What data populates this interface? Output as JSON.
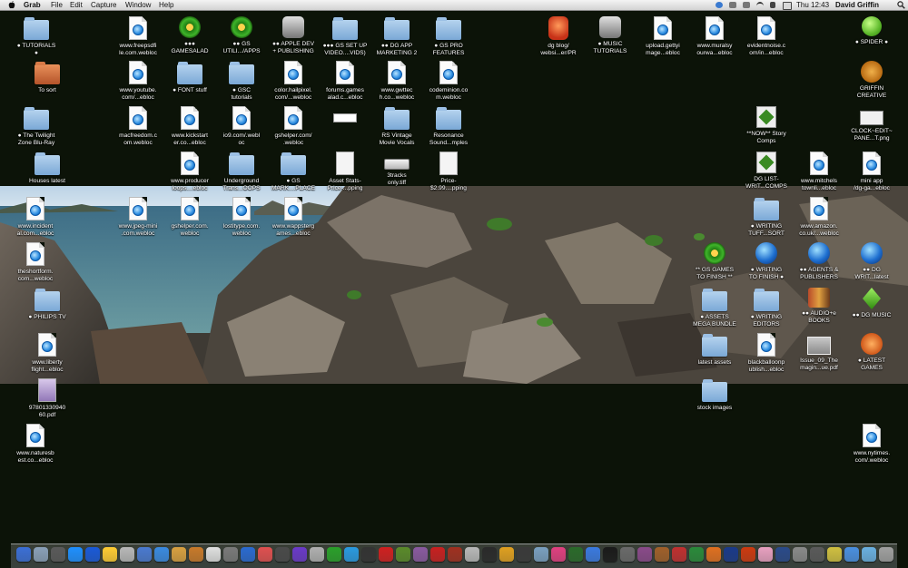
{
  "menubar": {
    "app": "Grab",
    "menus": [
      "File",
      "Edit",
      "Capture",
      "Window",
      "Help"
    ],
    "clock": "Thu 12:43",
    "user": "David Griffin"
  },
  "desktop_icons": [
    {
      "label": "● TUTORIALS\n●",
      "type": "folder"
    },
    {
      "label": "To sort",
      "type": "folder-orange"
    },
    {
      "label": "● The Twilight\nZone Blu-Ray",
      "type": "folder"
    },
    {
      "label": "Houses latest",
      "type": "folder"
    },
    {
      "label": "www.incident\nal.com...ebloc",
      "type": "webloc"
    },
    {
      "label": "theshortform.\ncom...webloc",
      "type": "webloc"
    },
    {
      "label": "● PHILIPS TV",
      "type": "folder"
    },
    {
      "label": "www.liberty\nflight...ebloc",
      "type": "webloc"
    },
    {
      "label": "97801330940\n60.pdf",
      "type": "doc-purple"
    },
    {
      "label": "www.naturesb\nest.co...ebloc",
      "type": "webloc"
    },
    {
      "label": "www.freepsdfi\nle.com.webloc",
      "type": "webloc"
    },
    {
      "label": "www.youtube.\ncom/...ebloc",
      "type": "webloc"
    },
    {
      "label": "macfreedom.c\nom.webloc",
      "type": "webloc"
    },
    {
      "label": "www.producer\nloops....ebloc",
      "type": "webloc"
    },
    {
      "label": "www.jpeg-mini\n.com.webloc",
      "type": "webloc"
    },
    {
      "label": "●●●\nGAMESALAD",
      "type": "wreath"
    },
    {
      "label": "● FONT stuff",
      "type": "folder"
    },
    {
      "label": "www.kickstart\ner.co...ebloc",
      "type": "webloc"
    },
    {
      "label": "Underground\nTrans...OOPS",
      "type": "folder"
    },
    {
      "label": "gshelper.com.\nwebloc",
      "type": "webloc"
    },
    {
      "label": "●● GS\nUTILI.../APPS",
      "type": "wreath"
    },
    {
      "label": "● GSC\ntutorials",
      "type": "folder"
    },
    {
      "label": "io9.com/.webl\noc",
      "type": "webloc"
    },
    {
      "label": "lostitype.com.\nwebloc",
      "type": "webloc"
    },
    {
      "label": "●● APPLE DEV\n+ PUBLISHING",
      "type": "app"
    },
    {
      "label": "color.hailpixel.\ncom/...webloc",
      "type": "webloc"
    },
    {
      "label": "gshelper.com/\n.webloc",
      "type": "webloc"
    },
    {
      "label": "● GS\nMARK....PLACE",
      "type": "folder"
    },
    {
      "label": "www.wappsterg\names...ebloc",
      "type": "webloc"
    },
    {
      "label": "●●● GS SET UP\nVIDEO....VIDS)",
      "type": "folder"
    },
    {
      "label": "forums.games\nalad.c...ebloc",
      "type": "webloc"
    },
    {
      "label": "Asset Stats-\nPrice-...pping",
      "type": "doc"
    },
    {
      "label": "●● DG APP\nMARKETING 2",
      "type": "folder"
    },
    {
      "label": "www.gwttec\nh.co...webloc",
      "type": "webloc"
    },
    {
      "label": "RS Vintage\nMovie Vocals",
      "type": "folder"
    },
    {
      "label": "3tracks\nonly.tiff",
      "type": "drive"
    },
    {
      "label": "● GS PRO\nFEATURES",
      "type": "folder"
    },
    {
      "label": "codeminion.co\nm.webloc",
      "type": "webloc"
    },
    {
      "label": "Resonance\nSound...mples",
      "type": "folder"
    },
    {
      "label": "Price-\n$2.99....pping",
      "type": "doc"
    },
    {
      "label": "dg blog/\nwebsi...er/PR",
      "type": "robot"
    },
    {
      "label": "● MUSIC\nTUTORIALS",
      "type": "app"
    },
    {
      "label": "upload.gettyi\nmage...ebloc",
      "type": "webloc"
    },
    {
      "label": "www.muralsy\nourwa...ebloc",
      "type": "webloc"
    },
    {
      "label": "evidentnoise.c\nom/in...ebloc",
      "type": "webloc"
    },
    {
      "label": "**NOW** Story\nComps",
      "type": "gxp"
    },
    {
      "label": "DG LIST-\nWRIT...COMPS",
      "type": "gxp"
    },
    {
      "label": "● WRITING\nTUFF...SORT",
      "type": "folder"
    },
    {
      "label": "** GS GAMES\nTO FINISH **",
      "type": "wreath"
    },
    {
      "label": "● ASSETS\nMEGA BUNDLE",
      "type": "folder"
    },
    {
      "label": "latest assets",
      "type": "folder"
    },
    {
      "label": "stock images",
      "type": "folder"
    },
    {
      "label": "● WRITING\nTO FINISH ●",
      "type": "orb"
    },
    {
      "label": "● WRITING\nEDITORS",
      "type": "folder"
    },
    {
      "label": "blackballoonp\nublish...ebloc",
      "type": "webloc"
    },
    {
      "label": "www.mitchels\ntownli...ebloc",
      "type": "webloc"
    },
    {
      "label": "www.amazon.\nco.uk/...webloc",
      "type": "webloc"
    },
    {
      "label": "●● AGENTS &\nPUBLISHERS",
      "type": "orb"
    },
    {
      "label": "●● AUDIO+e\nBOOKS",
      "type": "books"
    },
    {
      "label": "Issue_09_The\nmagin...ue.pdf",
      "type": "img"
    },
    {
      "label": "● SPIDER ●",
      "type": "apple"
    },
    {
      "label": "GRIFFIN\nCREATIVE",
      "type": "bear"
    },
    {
      "label": "CLOCK~EDIT~\nPANE...T.png",
      "type": "clock"
    },
    {
      "label": "mini app\n/dg-ga...ebloc",
      "type": "webloc"
    },
    {
      "label": "●● DG\nWRIT...latest",
      "type": "orb"
    },
    {
      "label": "●● DG MUSIC",
      "type": "gem"
    },
    {
      "label": "● LATEST\nGAMES",
      "type": "fox"
    },
    {
      "label": "www.nytimes.\ncom/.webloc",
      "type": "webloc"
    },
    {
      "label": "",
      "type": "blank"
    }
  ],
  "dock_colors": [
    "#3b6fd6",
    "#8aa0b8",
    "#5a5a5a",
    "#1e90ff",
    "#1a5ad8",
    "#ffcc33",
    "#b8b8b8",
    "#4a7ad0",
    "#3a8ae0",
    "#d8a040",
    "#c87a2a",
    "#e0e0e0",
    "#7a7a7a",
    "#2a6ad0",
    "#e05050",
    "#4a4a4a",
    "#6a3ac8",
    "#b0b0b0",
    "#2aa02a",
    "#2a9ae0",
    "#333333",
    "#d02020",
    "#5a8a2a",
    "#8a5aa0",
    "#c82020",
    "#a03020",
    "#b8b8b8",
    "#2a2a2a",
    "#e0a020",
    "#3a3a3a",
    "#7aa0c0",
    "#e04080",
    "#2a6a2a",
    "#3a7ae0",
    "#1a1a1a",
    "#6a6a6a",
    "#8a4a8a",
    "#a0602a",
    "#c03030",
    "#2a8a3a",
    "#e07020",
    "#1a3a8a",
    "#cc3a10",
    "#e8a0c0",
    "#2a4a8a",
    "#8a8a8a",
    "#5a5a5a",
    "#d0c040",
    "#4a90e0",
    "#6ab0e0",
    "#a0a0a0"
  ]
}
